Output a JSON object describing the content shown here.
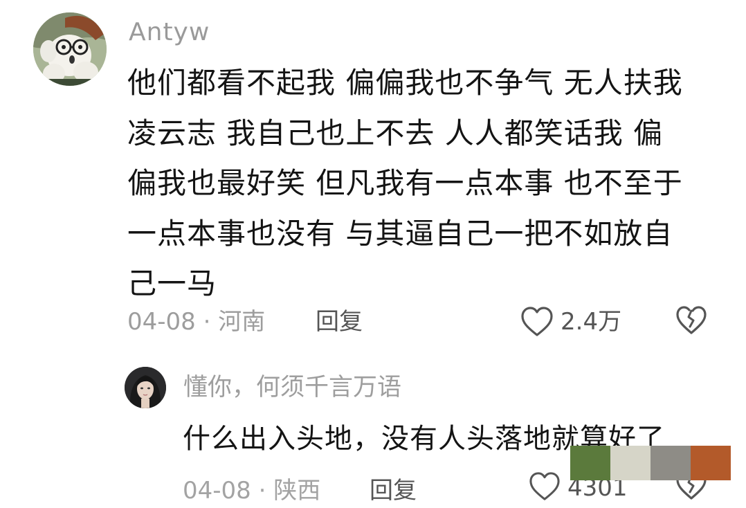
{
  "main_comment": {
    "username": "Antyw",
    "text_lines": [
      "他们都看不起我 偏偏我也不争气 无人扶我",
      "凌云志 我自己也上不去 人人都笑话我 偏",
      "偏我也最好笑 但凡我有一点本事 也不至于",
      "一点本事也没有 与其逼自己一把不如放自",
      "己一马"
    ],
    "date": "04-08",
    "separator": "·",
    "location": "河南",
    "reply_label": "回复",
    "like_count": "2.4万",
    "like_icon": "heart-outline-icon",
    "dislike_icon": "broken-heart-icon"
  },
  "reply_comment": {
    "username": "懂你，何须千言万语",
    "text": "什么出入头地，没有人头落地就算好了",
    "date": "04-08",
    "separator": "·",
    "location": "陕西",
    "reply_label": "回复",
    "like_count": "4301",
    "like_icon": "heart-outline-icon",
    "dislike_icon": "broken-heart-icon"
  },
  "palette": {
    "colors": [
      "#5b7a3c",
      "#d6d5c8",
      "#8e8c86",
      "#b35a2a"
    ]
  },
  "colors": {
    "text_primary": "#141414",
    "text_secondary": "#9d9d9d",
    "action_text": "#555555",
    "background": "#ffffff"
  }
}
